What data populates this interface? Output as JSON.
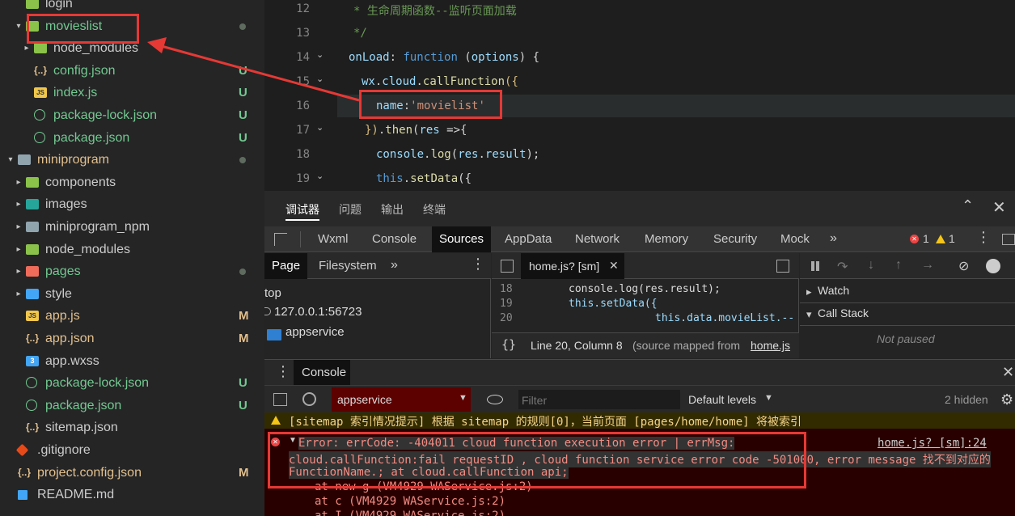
{
  "explorer": {
    "items": [
      {
        "label": "login",
        "color": "def",
        "status": "",
        "icon": "folder-icon"
      },
      {
        "label": "movieslist",
        "color": "new",
        "status": "dot",
        "icon": "folder-icon"
      },
      {
        "label": "node_modules",
        "color": "def",
        "status": "",
        "icon": "folder-icon"
      },
      {
        "label": "config.json",
        "color": "new",
        "status": "U",
        "icon": "json-icon"
      },
      {
        "label": "index.js",
        "color": "new",
        "status": "U",
        "icon": "js-icon"
      },
      {
        "label": "package-lock.json",
        "color": "new",
        "status": "U",
        "icon": "package-json-icon"
      },
      {
        "label": "package.json",
        "color": "new",
        "status": "U",
        "icon": "package-json-icon"
      },
      {
        "label": "miniprogram",
        "color": "mod",
        "status": "dot",
        "icon": "folder-icon"
      },
      {
        "label": "components",
        "color": "def",
        "status": "",
        "icon": "folder-icon"
      },
      {
        "label": "images",
        "color": "def",
        "status": "",
        "icon": "folder-icon"
      },
      {
        "label": "miniprogram_npm",
        "color": "def",
        "status": "",
        "icon": "folder-icon"
      },
      {
        "label": "node_modules",
        "color": "def",
        "status": "",
        "icon": "folder-icon"
      },
      {
        "label": "pages",
        "color": "new",
        "status": "dot",
        "icon": "folder-icon"
      },
      {
        "label": "style",
        "color": "def",
        "status": "",
        "icon": "folder-icon"
      },
      {
        "label": "app.js",
        "color": "mod",
        "status": "M",
        "icon": "js-icon"
      },
      {
        "label": "app.json",
        "color": "mod",
        "status": "M",
        "icon": "json-icon"
      },
      {
        "label": "app.wxss",
        "color": "def",
        "status": "",
        "icon": "wxss-icon"
      },
      {
        "label": "package-lock.json",
        "color": "new",
        "status": "U",
        "icon": "package-json-icon"
      },
      {
        "label": "package.json",
        "color": "new",
        "status": "U",
        "icon": "package-json-icon"
      },
      {
        "label": "sitemap.json",
        "color": "def",
        "status": "",
        "icon": "json-icon"
      },
      {
        "label": ".gitignore",
        "color": "def",
        "status": "",
        "icon": "git-icon"
      },
      {
        "label": "project.config.json",
        "color": "mod",
        "status": "M",
        "icon": "json-icon"
      },
      {
        "label": "README.md",
        "color": "def",
        "status": "",
        "icon": "markdown-icon"
      }
    ]
  },
  "editor": {
    "lines": [
      {
        "num": "12",
        "code": [
          {
            "t": "* 生命周期函数--监听页面加载",
            "c": "cm"
          }
        ]
      },
      {
        "num": "13",
        "code": [
          {
            "t": "*/",
            "c": "cm"
          }
        ]
      },
      {
        "num": "14",
        "code": [
          {
            "t": "onLoad",
            "c": "prop"
          },
          {
            "t": ": ",
            "c": "pun"
          },
          {
            "t": "function",
            "c": "kw"
          },
          {
            "t": " (",
            "c": "pun"
          },
          {
            "t": "options",
            "c": "prop"
          },
          {
            "t": ") {",
            "c": "pun"
          }
        ]
      },
      {
        "num": "15",
        "code": [
          {
            "t": "wx",
            "c": "prop"
          },
          {
            "t": ".",
            "c": "pun"
          },
          {
            "t": "cloud",
            "c": "prop"
          },
          {
            "t": ".",
            "c": "pun"
          },
          {
            "t": "callFunction",
            "c": "fn"
          },
          {
            "t": "({",
            "c": "orange"
          }
        ]
      },
      {
        "num": "16",
        "code": [
          {
            "t": "name",
            "c": "prop"
          },
          {
            "t": ":",
            "c": "pun"
          },
          {
            "t": "'movielist'",
            "c": "str"
          }
        ]
      },
      {
        "num": "17",
        "code": [
          {
            "t": "})",
            "c": "orange"
          },
          {
            "t": ".",
            "c": "pun"
          },
          {
            "t": "then",
            "c": "fn"
          },
          {
            "t": "(",
            "c": "pun"
          },
          {
            "t": "res",
            "c": "prop"
          },
          {
            "t": " =>{",
            "c": "pun"
          }
        ]
      },
      {
        "num": "18",
        "code": [
          {
            "t": "console",
            "c": "prop"
          },
          {
            "t": ".",
            "c": "pun"
          },
          {
            "t": "log",
            "c": "fn"
          },
          {
            "t": "(",
            "c": "pun"
          },
          {
            "t": "res",
            "c": "prop"
          },
          {
            "t": ".",
            "c": "pun"
          },
          {
            "t": "result",
            "c": "prop"
          },
          {
            "t": ");",
            "c": "pun"
          }
        ]
      },
      {
        "num": "19",
        "code": [
          {
            "t": "this",
            "c": "kw"
          },
          {
            "t": ".",
            "c": "pun"
          },
          {
            "t": "setData",
            "c": "fn"
          },
          {
            "t": "({",
            "c": "pun"
          }
        ]
      }
    ]
  },
  "devtools": {
    "top_tabs": [
      "调试器",
      "问题",
      "输出",
      "终端"
    ],
    "panel_tabs": [
      "Wxml",
      "Console",
      "Sources",
      "AppData",
      "Network",
      "Memory",
      "Security",
      "Mock"
    ],
    "active_panel": "Sources",
    "error_count": "1",
    "warning_count": "1",
    "navigator": {
      "tabs": [
        "Page",
        "Filesystem"
      ],
      "tree": [
        "top",
        "127.0.0.1:56723",
        "appservice"
      ]
    },
    "source": {
      "file_tab": "home.js? [sm]",
      "lines": [
        {
          "num": "18",
          "text": "console.log(res.result);"
        },
        {
          "num": "19",
          "text": "this.setData({"
        },
        {
          "num": "20",
          "text": "this.data.movieList.--"
        }
      ],
      "status": "Line 20, Column 8",
      "mapped_prefix": "(source mapped from ",
      "mapped_link": "home.js"
    },
    "debugger": {
      "watch": "Watch",
      "call_stack": "Call Stack",
      "not_paused": "Not paused"
    },
    "console": {
      "tab": "Console",
      "context": "appservice",
      "filter_placeholder": "Filter",
      "levels": "Default levels",
      "hidden": "2 hidden",
      "sitemap_warning": "[sitemap 索引情况提示] 根据 sitemap 的规则[0]，当前页面 [pages/home/home] 将被索引",
      "error_line1": "Error: errCode: -404011 cloud function execution error | errMsg:",
      "error_line2": "cloud.callFunction:fail requestID , cloud function service error code -501000, error message 找不到对应的",
      "error_line3": "FunctionName.; at cloud.callFunction api;",
      "error_source": "home.js? [sm]:24",
      "stack": [
        "at new g (VM4929 WAService.js:2)",
        "at c (VM4929 WAService.js:2)",
        "at I (VM4929 WAService.js:2)"
      ]
    }
  }
}
